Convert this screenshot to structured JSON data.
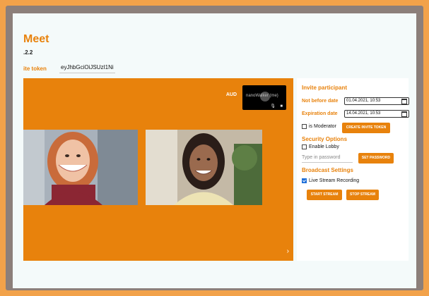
{
  "app": {
    "title": "Meet",
    "version": ".2.2",
    "invite_label": "ite token",
    "invite_token": "eyJhbGciOiJSUzI1Ni"
  },
  "stage": {
    "aud_label": "AUD",
    "self_name": "nanoWalker (me)",
    "arrow": "›"
  },
  "panel": {
    "invite_heading": "Invite participant",
    "not_before_label": "Not before date",
    "not_before_value": "01.04.2021, 10:53",
    "expiration_label": "Expiration date",
    "expiration_value": "14.04.2021, 10:53",
    "is_moderator_label": "is Moderator",
    "is_moderator_checked": false,
    "create_token_button": "CREATE INVITE TOKEN",
    "security_heading": "Security Options",
    "enable_lobby_label": "Enable Lobby",
    "enable_lobby_checked": false,
    "password_placeholder": "Type in password",
    "set_password_button": "SET PASSWORD",
    "broadcast_heading": "Broadcast Settings",
    "live_stream_label": "Live Stream Recording",
    "live_stream_checked": true,
    "start_stream_button": "START STREAM",
    "stop_stream_button": "STOP STREAM"
  },
  "colors": {
    "accent": "#e8820c",
    "outer_background": "#f2a24a",
    "frame": "#8c7f7a",
    "page": "#f4fafa"
  }
}
